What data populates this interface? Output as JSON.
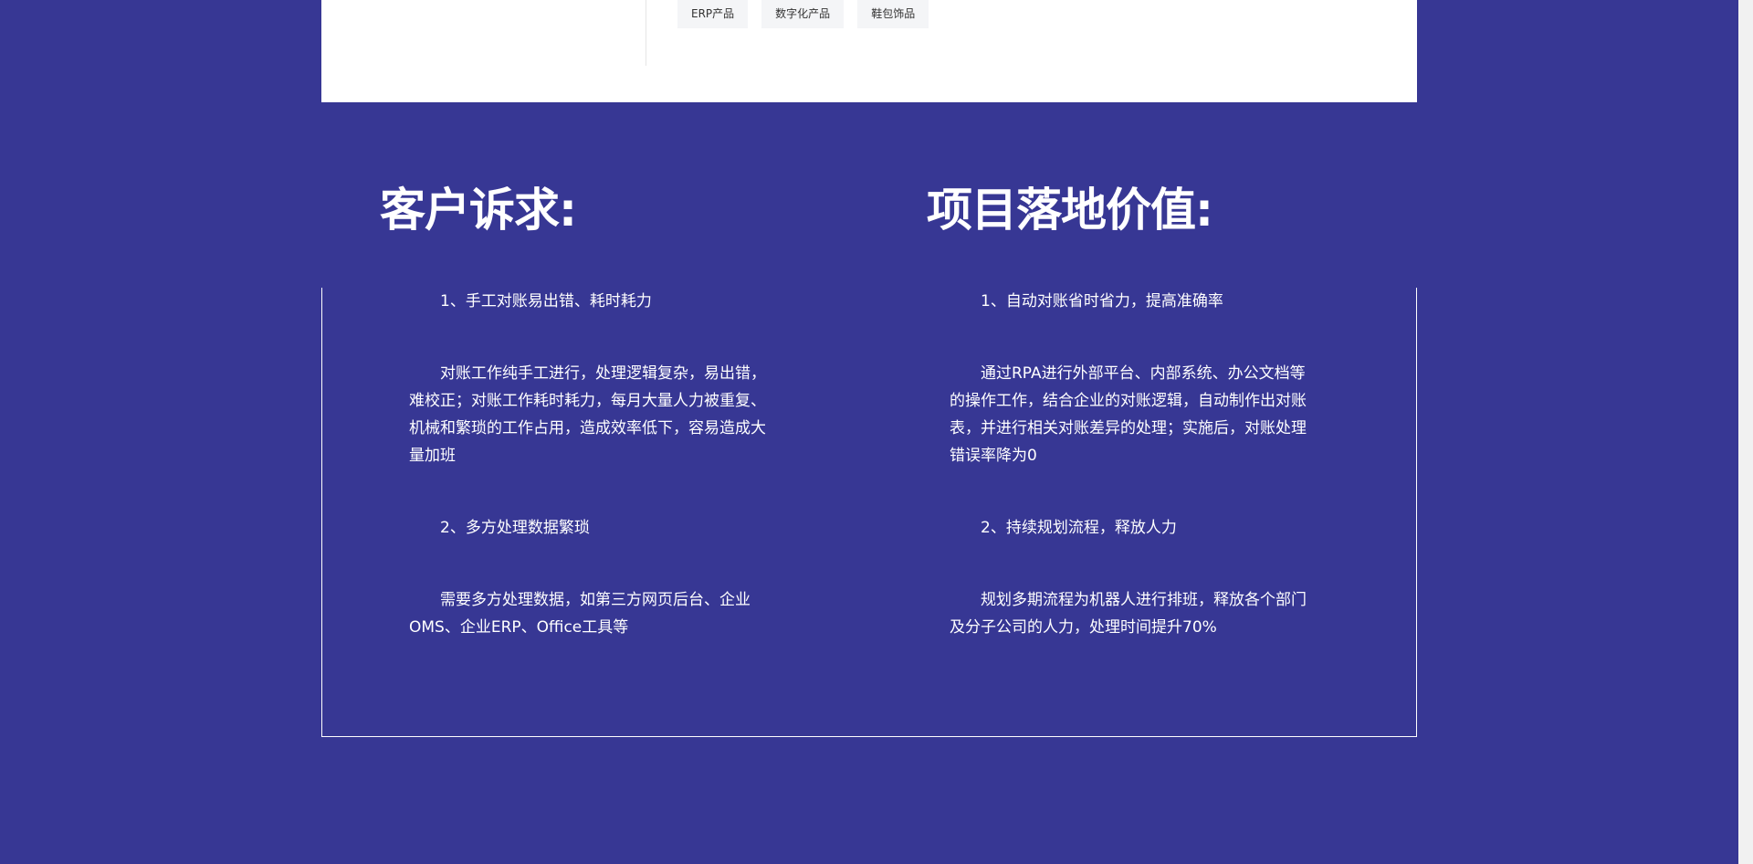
{
  "tags": [
    "ERP产品",
    "数字化产品",
    "鞋包饰品"
  ],
  "left": {
    "heading": "客户诉求:",
    "items": [
      {
        "title": "1、手工对账易出错、耗时耗力",
        "body": "对账工作纯手工进行，处理逻辑复杂，易出错，难校正；对账工作耗时耗力，每月大量人力被重复、机械和繁琐的工作占用，造成效率低下，容易造成大量加班"
      },
      {
        "title": "2、多方处理数据繁琐",
        "body": "需要多方处理数据，如第三方网页后台、企业OMS、企业ERP、Office工具等"
      }
    ]
  },
  "right": {
    "heading": "项目落地价值:",
    "items": [
      {
        "title": "1、自动对账省时省力，提高准确率",
        "body": "通过RPA进行外部平台、内部系统、办公文档等的操作工作，结合企业的对账逻辑，自动制作出对账表，并进行相关对账差异的处理；实施后，对账处理错误率降为0"
      },
      {
        "title": "2、持续规划流程，释放人力",
        "body": "规划多期流程为机器人进行排班，释放各个部门及分子公司的人力，处理时间提升70%"
      }
    ]
  },
  "colors": {
    "background": "#373794",
    "text": "#ffffff",
    "tag_bg": "#f4f5f7"
  }
}
